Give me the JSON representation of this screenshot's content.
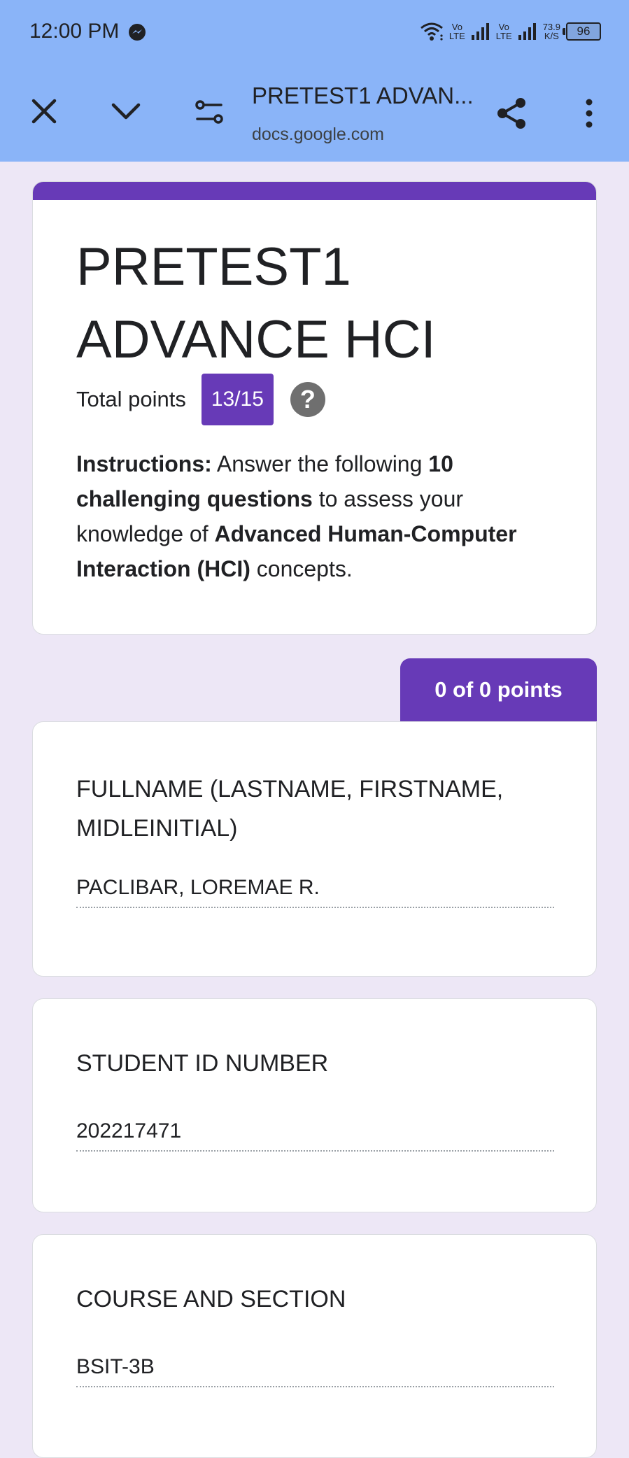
{
  "status_bar": {
    "time": "12:00 PM",
    "net1_top": "Vo",
    "net1_bottom": "LTE",
    "net2_top": "Vo",
    "net2_bottom": "LTE",
    "speed_value": "73.9",
    "speed_unit": "K/S",
    "battery": "96",
    "icons": [
      "messenger-icon",
      "wifi-icon",
      "signal-icon",
      "signal-icon",
      "battery-icon"
    ]
  },
  "browser": {
    "title": "PRETEST1 ADVAN...",
    "url": "docs.google.com",
    "icons": [
      "close-icon",
      "chevron-down-icon",
      "site-settings-icon",
      "share-icon",
      "more-vert-icon"
    ]
  },
  "form": {
    "title": "PRETEST1 ADVANCE HCI",
    "total_points_label": "Total points",
    "score": "13/15",
    "help_glyph": "?",
    "instructions": {
      "lead": "Instructions:",
      "t1": " Answer the following ",
      "b1": "10 challenging questions",
      "t2": " to assess your knowledge of ",
      "b2": "Advanced Human-Computer Interaction (HCI)",
      "t3": " concepts."
    },
    "accent_color": "#673ab7"
  },
  "section": {
    "points": "0 of 0 points"
  },
  "questions": [
    {
      "label": "FULLNAME (LASTNAME, FIRSTNAME, MIDLEINITIAL)",
      "answer": "PACLIBAR, LOREMAE R."
    },
    {
      "label": "STUDENT ID NUMBER",
      "answer": "202217471"
    },
    {
      "label": "COURSE AND SECTION",
      "answer": "BSIT-3B"
    }
  ]
}
